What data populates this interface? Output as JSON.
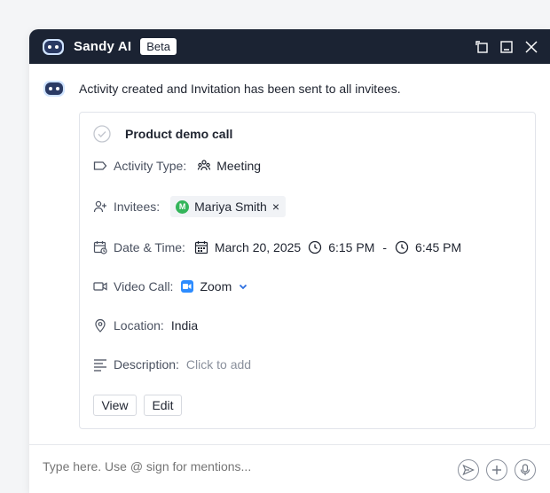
{
  "window": {
    "title": "Sandy AI",
    "badge": "Beta"
  },
  "message": {
    "text": "Activity created and Invitation has been sent to all invitees."
  },
  "activity": {
    "title": "Product demo call",
    "activity_type": {
      "label": "Activity Type:",
      "value": "Meeting"
    },
    "invitees": {
      "label": "Invitees:",
      "people": [
        {
          "initial": "M",
          "name": "Mariya Smith",
          "remove": "×"
        }
      ]
    },
    "date_time": {
      "label": "Date & Time:",
      "date": "March 20, 2025",
      "start": "6:15 PM",
      "separator": "-",
      "end": "6:45 PM"
    },
    "video_call": {
      "label": "Video Call:",
      "value": "Zoom"
    },
    "location": {
      "label": "Location:",
      "value": "India"
    },
    "description": {
      "label": "Description:",
      "value": "Click to add"
    },
    "buttons": {
      "view": "View",
      "edit": "Edit"
    }
  },
  "composer": {
    "placeholder": "Type here. Use @ sign for mentions..."
  },
  "colors": {
    "titlebar": "#1b2333",
    "accent_blue": "#2d8cff",
    "avatar_green": "#34b55a"
  },
  "icons": [
    "bot-icon",
    "expand-icon",
    "maximize-icon",
    "close-icon",
    "check-circle-icon",
    "tag-icon",
    "meeting-icon",
    "add-user-icon",
    "calendar-icon",
    "clock-icon",
    "video-icon",
    "zoom-icon",
    "chevron-down-icon",
    "location-pin-icon",
    "description-icon",
    "send-icon",
    "plus-icon",
    "mic-icon"
  ]
}
